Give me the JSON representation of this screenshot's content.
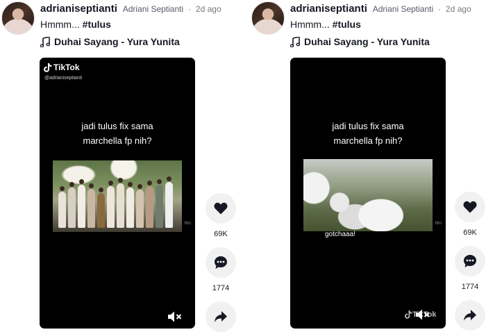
{
  "posts": [
    {
      "username": "adrianiseptianti",
      "nickname": "Adriani Septianti",
      "separator": "·",
      "time": "2d ago",
      "caption_text": "Hmmm...",
      "hashtag": "#tulus",
      "music": "Duhai Sayang - Yura Yunita",
      "video": {
        "watermark_brand": "TikTok",
        "watermark_handle": "@adrianiseptianti",
        "overlay_line1": "jadi tulus fix sama",
        "overlay_line2": "marchella fp nih?",
        "corner_tag": "film"
      },
      "likes": "69K",
      "comments": "1774"
    },
    {
      "username": "adrianiseptianti",
      "nickname": "Adriani Septianti",
      "separator": "·",
      "time": "2d ago",
      "caption_text": "Hmmm...",
      "hashtag": "#tulus",
      "music": "Duhai Sayang - Yura Yunita",
      "video": {
        "overlay_line1": "jadi tulus fix sama",
        "overlay_line2": "marchella fp nih?",
        "subtitle": "gotchaaa!",
        "watermark_brand": "TikTok",
        "corner_tag": "film"
      },
      "likes": "69K",
      "comments": "1774"
    }
  ],
  "icons": [
    "avatar",
    "music-note-icon",
    "tiktok-logo-icon",
    "mute-icon",
    "heart-icon",
    "comment-icon",
    "share-icon"
  ]
}
